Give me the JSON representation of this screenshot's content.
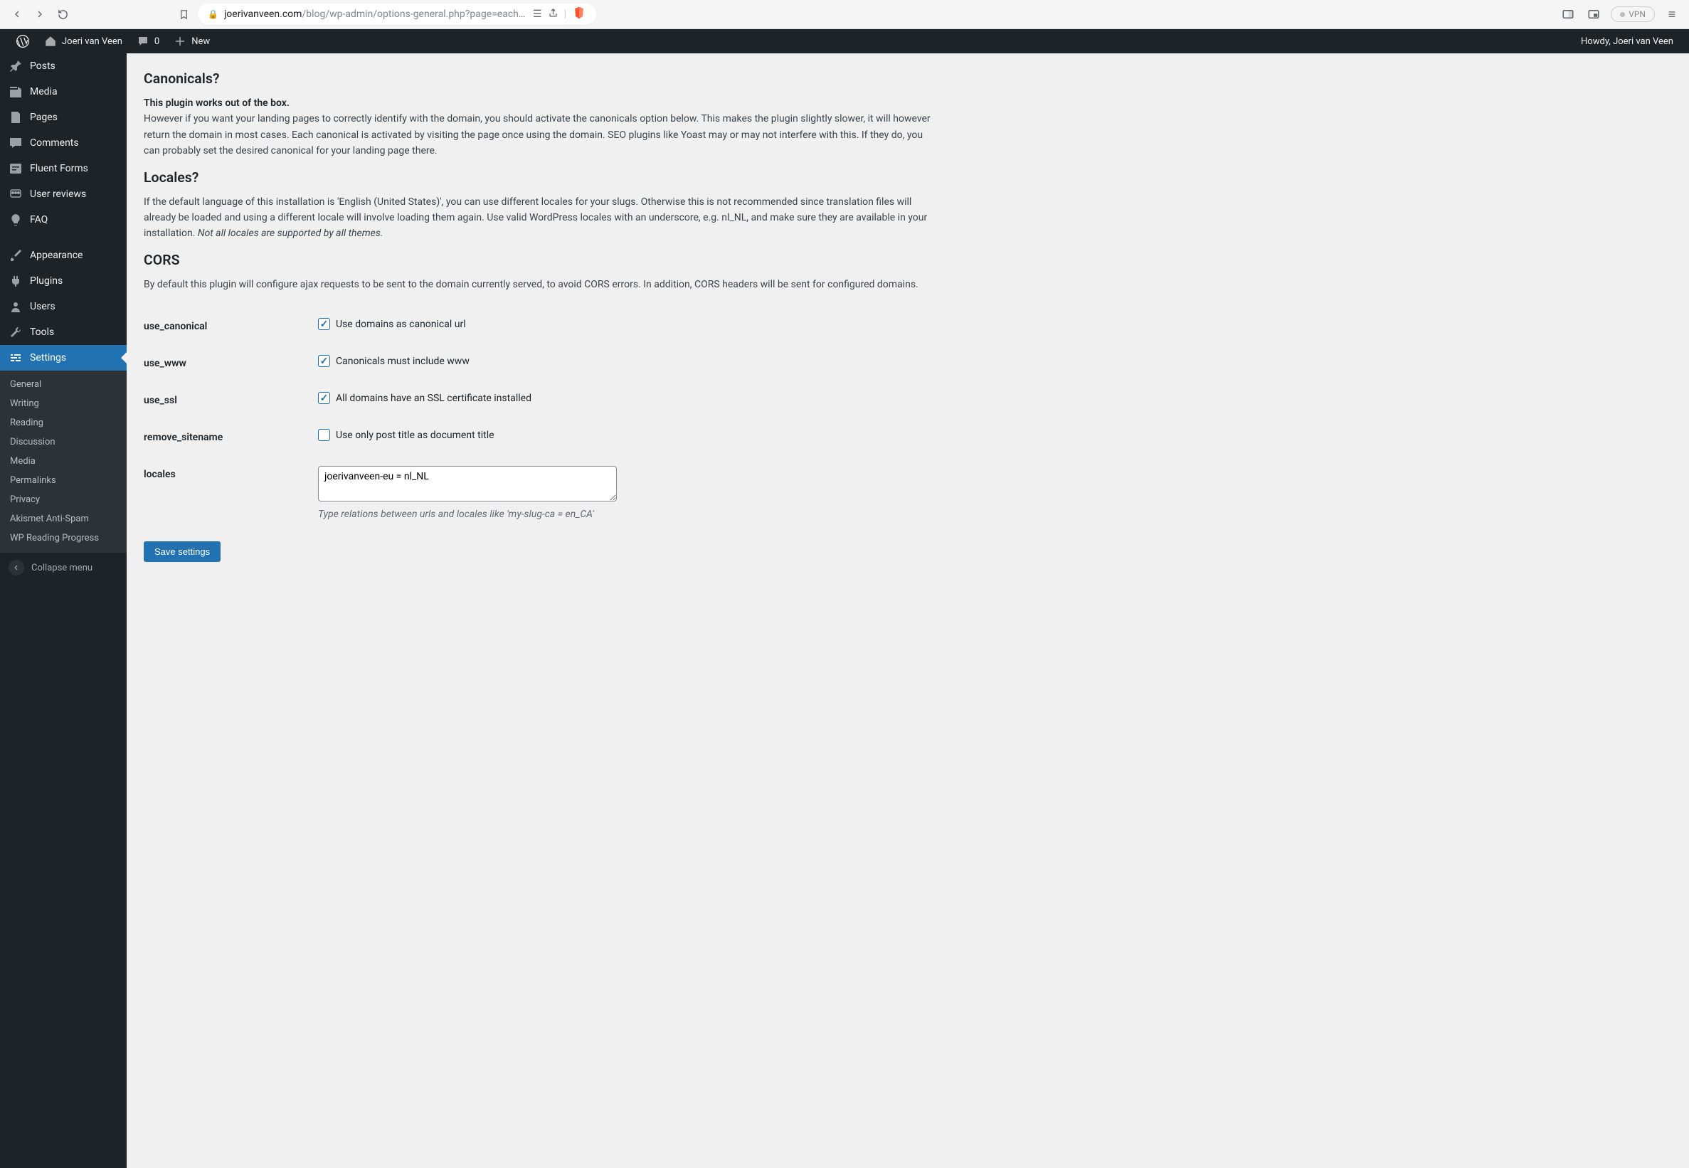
{
  "browser": {
    "url_domain": "joerivanveen.com",
    "url_path": "/blog/wp-admin/options-general.php?page=each-...",
    "vpn_label": "VPN"
  },
  "adminbar": {
    "site_name": "Joeri van Veen",
    "comment_count": "0",
    "new_label": "New",
    "howdy": "Howdy, Joeri van Veen"
  },
  "sidebar": {
    "posts": "Posts",
    "media": "Media",
    "pages": "Pages",
    "comments": "Comments",
    "fluent_forms": "Fluent Forms",
    "user_reviews": "User reviews",
    "faq": "FAQ",
    "appearance": "Appearance",
    "plugins": "Plugins",
    "users": "Users",
    "tools": "Tools",
    "settings": "Settings",
    "submenu": {
      "general": "General",
      "writing": "Writing",
      "reading": "Reading",
      "discussion": "Discussion",
      "media": "Media",
      "permalinks": "Permalinks",
      "privacy": "Privacy",
      "akismet": "Akismet Anti-Spam",
      "wp_reading_progress": "WP Reading Progress"
    },
    "collapse": "Collapse menu"
  },
  "content": {
    "h_canonicals": "Canonicals?",
    "p_canonicals_strong": "This plugin works out of the box.",
    "p_canonicals_rest": "However if you want your landing pages to correctly identify with the domain, you should activate the canonicals option below. This makes the plugin slightly slower, it will however return the domain in most cases. Each canonical is activated by visiting the page once using the domain. SEO plugins like Yoast may or may not interfere with this. If they do, you can probably set the desired canonical for your landing page there.",
    "h_locales": "Locales?",
    "p_locales_main": "If the default language of this installation is 'English (United States)', you can use different locales for your slugs. Otherwise this is not recommended since translation files will already be loaded and using a different locale will involve loading them again. Use valid WordPress locales with an underscore, e.g. nl_NL, and make sure they are available in your installation. ",
    "p_locales_em": "Not all locales are supported by all themes.",
    "h_cors": "CORS",
    "p_cors": "By default this plugin will configure ajax requests to be sent to the domain currently served, to avoid CORS errors. In addition, CORS headers will be sent for configured domains.",
    "fields": {
      "use_canonical": {
        "label": "use_canonical",
        "text": "Use domains as canonical url",
        "checked": true
      },
      "use_www": {
        "label": "use_www",
        "text": "Canonicals must include www",
        "checked": true
      },
      "use_ssl": {
        "label": "use_ssl",
        "text": "All domains have an SSL certificate installed",
        "checked": true
      },
      "remove_sitename": {
        "label": "remove_sitename",
        "text": "Use only post title as document title",
        "checked": false
      },
      "locales": {
        "label": "locales",
        "value": "joerivanveen-eu = nl_NL",
        "hint": "Type relations between urls and locales like 'my-slug-ca = en_CA'"
      }
    },
    "save_button": "Save settings"
  }
}
